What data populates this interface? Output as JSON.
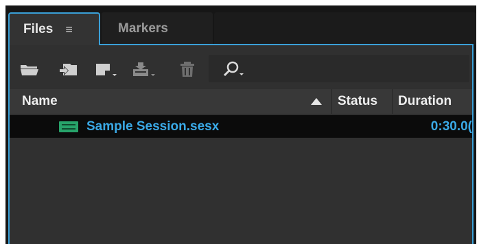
{
  "tabs": [
    {
      "label": "Files",
      "active": true,
      "menu_icon": "hamburger-menu-icon"
    },
    {
      "label": "Markers",
      "active": false
    }
  ],
  "toolbar": {
    "buttons": [
      {
        "name": "open-file",
        "icon": "folder-open-icon"
      },
      {
        "name": "import-file",
        "icon": "import-icon"
      },
      {
        "name": "new-file",
        "icon": "new-file-icon",
        "has_dropdown": true
      },
      {
        "name": "insert-into-multitrack",
        "icon": "insert-icon",
        "has_dropdown": true
      },
      {
        "name": "delete",
        "icon": "trash-icon"
      },
      {
        "name": "search",
        "icon": "search-icon",
        "has_dropdown": true
      }
    ]
  },
  "table": {
    "columns": [
      "Name",
      "Status",
      "Duration"
    ],
    "sort": {
      "column": "Name",
      "direction": "ascending"
    },
    "rows": [
      {
        "icon": "multitrack-session-icon",
        "name": "Sample Session.sesx",
        "status": "",
        "duration": "0:30.0("
      }
    ]
  },
  "colors": {
    "accent": "#3aa0d8",
    "file_text": "#3aa9e6",
    "session_icon": "#27a36a",
    "panel_bg": "#303030"
  }
}
